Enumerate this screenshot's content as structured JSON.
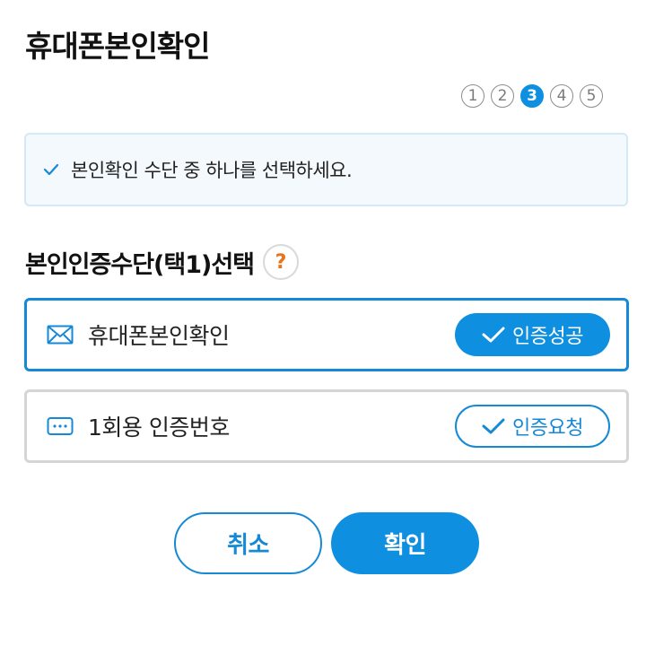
{
  "header": {
    "title": "휴대폰본인확인"
  },
  "steps": {
    "items": [
      "1",
      "2",
      "3",
      "4",
      "5"
    ],
    "current": 3
  },
  "notice": {
    "icon": "check-icon",
    "text": "본인확인 수단 중 하나를 선택하세요."
  },
  "method_section": {
    "title": "본인인증수단(택1)선택",
    "help_label": "?"
  },
  "options": [
    {
      "icon": "envelope-icon",
      "label": "휴대폰본인확인",
      "status_label": "인증성공",
      "selected": true
    },
    {
      "icon": "keypad-icon",
      "label": "1회용 인증번호",
      "status_label": "인증요청",
      "selected": false
    }
  ],
  "footer": {
    "cancel_label": "취소",
    "confirm_label": "확인"
  },
  "colors": {
    "accent": "#0f8fe0",
    "help_mark": "#e8731d",
    "notice_bg": "#f4f9fd"
  }
}
